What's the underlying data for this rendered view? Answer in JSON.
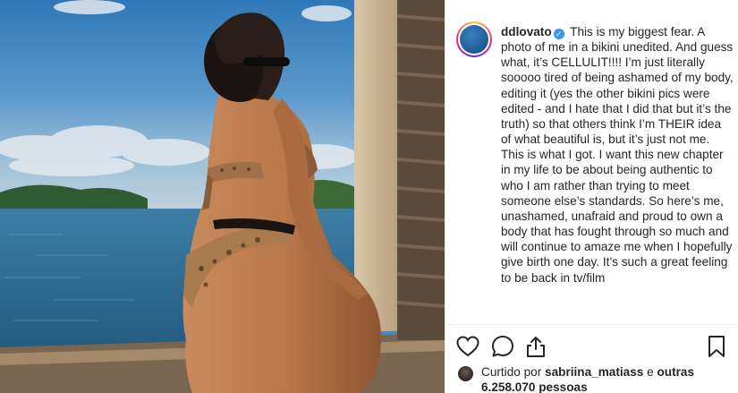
{
  "post": {
    "username": "ddlovato",
    "verified": true,
    "verified_glyph": "✓",
    "caption": "This is my biggest fear. A photo of me in a bikini unedited. And guess what, it’s CELLULIT!!!! I’m just literally sooooo tired of being ashamed of my body, editing it (yes the other bikini pics were edited - and I hate that I did that but it’s the truth) so that others think I’m THEIR idea of what beautiful is, but it’s just not me. This is what I got. I want this new chapter in my life to be about being authentic to who I am rather than trying to meet someone else’s standards. So here’s me, unashamed, unafraid and proud to own a body that has fought through so much and will continue to amaze me when I hopefully give birth one day. It’s such a great feeling to be back in tv/film"
  },
  "icons": {
    "like": "heart-icon",
    "comment": "comment-bubble-icon",
    "share": "share-icon",
    "save": "bookmark-icon",
    "verified": "verified-badge-icon"
  },
  "likes": {
    "prefix": "Curtido por",
    "user": "sabriina_matiass",
    "conjunction": "e",
    "others": "outras 6.258.070 pessoas"
  },
  "colors": {
    "text": "#262626",
    "verified": "#3897f0",
    "divider": "#efefef",
    "sky": "#4a86b8",
    "sea": "#2f6d96"
  }
}
